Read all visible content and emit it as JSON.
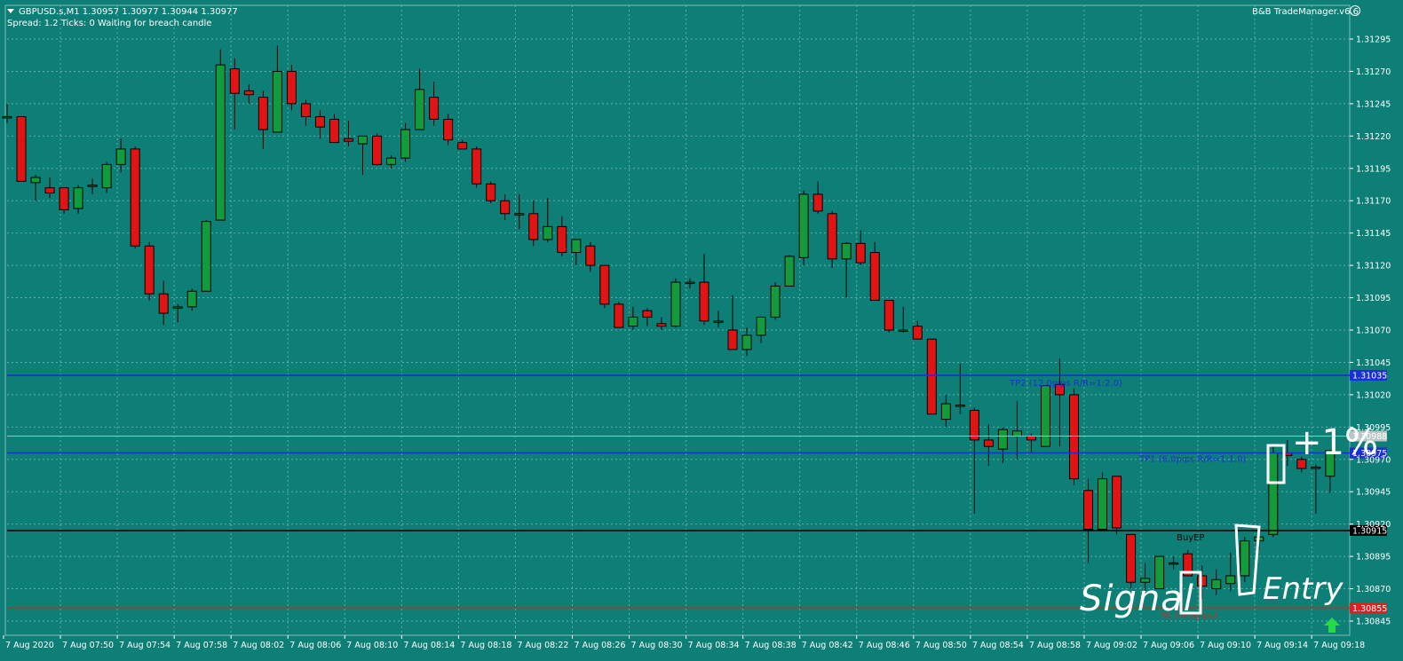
{
  "header": {
    "symbol_line": "GBPUSD.s,M1  1.30957 1.30977 1.30944 1.30977",
    "status_line": "Spread: 1.2   Ticks: 0   Waiting for breach candle",
    "brand": "B&B TradeManager.v6.6"
  },
  "colors": {
    "background": "#0e7f76",
    "bull": "#139a3b",
    "bear": "#e01414",
    "tp_line": "#1b2fd6",
    "entry_line": "#000000",
    "sl_line": "#e02020"
  },
  "chart_data": {
    "type": "candlestick",
    "ylim": [
      1.30835,
      1.3131
    ],
    "y_ticks": [
      "1.31295",
      "1.31270",
      "1.31245",
      "1.31220",
      "1.31195",
      "1.31170",
      "1.31145",
      "1.31120",
      "1.31095",
      "1.31070",
      "1.31045",
      "1.31020",
      "1.30995",
      "1.30970",
      "1.30945",
      "1.30920",
      "1.30895",
      "1.30870",
      "1.30845"
    ],
    "x_tick_labels": [
      "7 Aug 2020",
      "7 Aug 07:50",
      "7 Aug 07:54",
      "7 Aug 07:58",
      "7 Aug 08:02",
      "7 Aug 08:06",
      "7 Aug 08:10",
      "7 Aug 08:14",
      "7 Aug 08:18",
      "7 Aug 08:22",
      "7 Aug 08:26",
      "7 Aug 08:30",
      "7 Aug 08:34",
      "7 Aug 08:38",
      "7 Aug 08:42",
      "7 Aug 08:46",
      "7 Aug 08:50",
      "7 Aug 08:54",
      "7 Aug 08:58",
      "7 Aug 09:02",
      "7 Aug 09:06",
      "7 Aug 09:10",
      "7 Aug 09:14",
      "7 Aug 09:18"
    ],
    "candles": [
      {
        "o": 1.31235,
        "h": 1.31245,
        "l": 1.3123,
        "c": 1.31235
      },
      {
        "o": 1.31235,
        "h": 1.31235,
        "l": 1.31185,
        "c": 1.31185
      },
      {
        "o": 1.31184,
        "h": 1.3119,
        "l": 1.3117,
        "c": 1.31188
      },
      {
        "o": 1.3118,
        "h": 1.31188,
        "l": 1.31172,
        "c": 1.31176
      },
      {
        "o": 1.3118,
        "h": 1.3118,
        "l": 1.3116,
        "c": 1.31163
      },
      {
        "o": 1.31164,
        "h": 1.31182,
        "l": 1.3116,
        "c": 1.3118
      },
      {
        "o": 1.31182,
        "h": 1.31187,
        "l": 1.31175,
        "c": 1.31182
      },
      {
        "o": 1.3118,
        "h": 1.312,
        "l": 1.31176,
        "c": 1.31198
      },
      {
        "o": 1.31198,
        "h": 1.31218,
        "l": 1.31192,
        "c": 1.3121
      },
      {
        "o": 1.3121,
        "h": 1.31212,
        "l": 1.31133,
        "c": 1.31135
      },
      {
        "o": 1.31135,
        "h": 1.31138,
        "l": 1.31093,
        "c": 1.31098
      },
      {
        "o": 1.31098,
        "h": 1.31108,
        "l": 1.31074,
        "c": 1.31083
      },
      {
        "o": 1.31087,
        "h": 1.3109,
        "l": 1.31076,
        "c": 1.31088
      },
      {
        "o": 1.31088,
        "h": 1.31102,
        "l": 1.31085,
        "c": 1.311
      },
      {
        "o": 1.311,
        "h": 1.31155,
        "l": 1.311,
        "c": 1.31154
      },
      {
        "o": 1.31155,
        "h": 1.31287,
        "l": 1.31155,
        "c": 1.31275
      },
      {
        "o": 1.31272,
        "h": 1.3128,
        "l": 1.31225,
        "c": 1.31253
      },
      {
        "o": 1.31255,
        "h": 1.3126,
        "l": 1.31245,
        "c": 1.31252
      },
      {
        "o": 1.3125,
        "h": 1.31255,
        "l": 1.3121,
        "c": 1.31225
      },
      {
        "o": 1.31223,
        "h": 1.3129,
        "l": 1.31223,
        "c": 1.3127
      },
      {
        "o": 1.3127,
        "h": 1.31275,
        "l": 1.3124,
        "c": 1.31245
      },
      {
        "o": 1.31245,
        "h": 1.31248,
        "l": 1.31228,
        "c": 1.31235
      },
      {
        "o": 1.31235,
        "h": 1.3124,
        "l": 1.31218,
        "c": 1.31227
      },
      {
        "o": 1.31233,
        "h": 1.31237,
        "l": 1.31215,
        "c": 1.31215
      },
      {
        "o": 1.31218,
        "h": 1.31232,
        "l": 1.31212,
        "c": 1.31216
      },
      {
        "o": 1.31214,
        "h": 1.3122,
        "l": 1.3119,
        "c": 1.3122
      },
      {
        "o": 1.3122,
        "h": 1.31222,
        "l": 1.31197,
        "c": 1.31198
      },
      {
        "o": 1.31198,
        "h": 1.31205,
        "l": 1.31195,
        "c": 1.31203
      },
      {
        "o": 1.31203,
        "h": 1.3123,
        "l": 1.312,
        "c": 1.31225
      },
      {
        "o": 1.31225,
        "h": 1.31272,
        "l": 1.31225,
        "c": 1.31256
      },
      {
        "o": 1.3125,
        "h": 1.31262,
        "l": 1.31228,
        "c": 1.31233
      },
      {
        "o": 1.31233,
        "h": 1.31237,
        "l": 1.31213,
        "c": 1.31217
      },
      {
        "o": 1.31215,
        "h": 1.31217,
        "l": 1.3121,
        "c": 1.3121
      },
      {
        "o": 1.3121,
        "h": 1.31212,
        "l": 1.3118,
        "c": 1.31183
      },
      {
        "o": 1.31183,
        "h": 1.31185,
        "l": 1.31168,
        "c": 1.3117
      },
      {
        "o": 1.3117,
        "h": 1.31175,
        "l": 1.31155,
        "c": 1.3116
      },
      {
        "o": 1.3116,
        "h": 1.31175,
        "l": 1.31148,
        "c": 1.3116
      },
      {
        "o": 1.3116,
        "h": 1.3117,
        "l": 1.31135,
        "c": 1.3114
      },
      {
        "o": 1.3114,
        "h": 1.31172,
        "l": 1.31138,
        "c": 1.3115
      },
      {
        "o": 1.3115,
        "h": 1.31158,
        "l": 1.31127,
        "c": 1.3113
      },
      {
        "o": 1.3113,
        "h": 1.31138,
        "l": 1.3112,
        "c": 1.3114
      },
      {
        "o": 1.31135,
        "h": 1.31138,
        "l": 1.31115,
        "c": 1.3112
      },
      {
        "o": 1.3112,
        "h": 1.3112,
        "l": 1.31087,
        "c": 1.3109
      },
      {
        "o": 1.3109,
        "h": 1.31092,
        "l": 1.31072,
        "c": 1.31072
      },
      {
        "o": 1.31073,
        "h": 1.31088,
        "l": 1.3107,
        "c": 1.3108
      },
      {
        "o": 1.31085,
        "h": 1.31087,
        "l": 1.31073,
        "c": 1.3108
      },
      {
        "o": 1.31075,
        "h": 1.3108,
        "l": 1.3107,
        "c": 1.31073
      },
      {
        "o": 1.31073,
        "h": 1.3111,
        "l": 1.31072,
        "c": 1.31107
      },
      {
        "o": 1.31107,
        "h": 1.3111,
        "l": 1.31102,
        "c": 1.31107
      },
      {
        "o": 1.31107,
        "h": 1.31129,
        "l": 1.31074,
        "c": 1.31077
      },
      {
        "o": 1.31077,
        "h": 1.31085,
        "l": 1.31072,
        "c": 1.31077
      },
      {
        "o": 1.3107,
        "h": 1.31097,
        "l": 1.31055,
        "c": 1.31055
      },
      {
        "o": 1.31055,
        "h": 1.31072,
        "l": 1.3105,
        "c": 1.31066
      },
      {
        "o": 1.31066,
        "h": 1.31077,
        "l": 1.3106,
        "c": 1.3108
      },
      {
        "o": 1.3108,
        "h": 1.31107,
        "l": 1.31078,
        "c": 1.31104
      },
      {
        "o": 1.31104,
        "h": 1.31128,
        "l": 1.31104,
        "c": 1.31127
      },
      {
        "o": 1.31126,
        "h": 1.31178,
        "l": 1.3112,
        "c": 1.31175
      },
      {
        "o": 1.31175,
        "h": 1.31185,
        "l": 1.3116,
        "c": 1.31162
      },
      {
        "o": 1.3116,
        "h": 1.31162,
        "l": 1.31118,
        "c": 1.31125
      },
      {
        "o": 1.31125,
        "h": 1.31138,
        "l": 1.31095,
        "c": 1.31137
      },
      {
        "o": 1.31137,
        "h": 1.31147,
        "l": 1.3112,
        "c": 1.31122
      },
      {
        "o": 1.3113,
        "h": 1.31138,
        "l": 1.31093,
        "c": 1.31093
      },
      {
        "o": 1.31093,
        "h": 1.31093,
        "l": 1.31068,
        "c": 1.3107
      },
      {
        "o": 1.3107,
        "h": 1.31088,
        "l": 1.31068,
        "c": 1.3107
      },
      {
        "o": 1.31073,
        "h": 1.31077,
        "l": 1.31063,
        "c": 1.31063
      },
      {
        "o": 1.31063,
        "h": 1.31063,
        "l": 1.31005,
        "c": 1.31005
      },
      {
        "o": 1.31001,
        "h": 1.3102,
        "l": 1.30995,
        "c": 1.31013
      },
      {
        "o": 1.31011,
        "h": 1.31044,
        "l": 1.31005,
        "c": 1.31012
      },
      {
        "o": 1.31008,
        "h": 1.3101,
        "l": 1.30928,
        "c": 1.30985
      },
      {
        "o": 1.30985,
        "h": 1.30997,
        "l": 1.30965,
        "c": 1.3098
      },
      {
        "o": 1.30978,
        "h": 1.30995,
        "l": 1.30967,
        "c": 1.30993
      },
      {
        "o": 1.30988,
        "h": 1.31015,
        "l": 1.3097,
        "c": 1.30992
      },
      {
        "o": 1.30988,
        "h": 1.3099,
        "l": 1.30975,
        "c": 1.30985
      },
      {
        "o": 1.3098,
        "h": 1.31027,
        "l": 1.3098,
        "c": 1.31027
      },
      {
        "o": 1.31028,
        "h": 1.31048,
        "l": 1.3098,
        "c": 1.3102
      },
      {
        "o": 1.3102,
        "h": 1.31025,
        "l": 1.3095,
        "c": 1.30955
      },
      {
        "o": 1.30946,
        "h": 1.30955,
        "l": 1.3089,
        "c": 1.30916
      },
      {
        "o": 1.30916,
        "h": 1.3096,
        "l": 1.30915,
        "c": 1.30955
      },
      {
        "o": 1.30957,
        "h": 1.30957,
        "l": 1.30912,
        "c": 1.30917
      },
      {
        "o": 1.30912,
        "h": 1.30912,
        "l": 1.3087,
        "c": 1.30875
      },
      {
        "o": 1.30875,
        "h": 1.3089,
        "l": 1.30865,
        "c": 1.30878
      },
      {
        "o": 1.3087,
        "h": 1.30895,
        "l": 1.3087,
        "c": 1.30895
      },
      {
        "o": 1.3089,
        "h": 1.30895,
        "l": 1.30885,
        "c": 1.3089
      },
      {
        "o": 1.30897,
        "h": 1.309,
        "l": 1.3088,
        "c": 1.3088
      },
      {
        "o": 1.3088,
        "h": 1.30888,
        "l": 1.30862,
        "c": 1.30872
      },
      {
        "o": 1.3087,
        "h": 1.30885,
        "l": 1.30865,
        "c": 1.30877
      },
      {
        "o": 1.30874,
        "h": 1.30898,
        "l": 1.30868,
        "c": 1.3088
      },
      {
        "o": 1.3088,
        "h": 1.3091,
        "l": 1.30875,
        "c": 1.30907
      },
      {
        "o": 1.30907,
        "h": 1.30912,
        "l": 1.309,
        "c": 1.3091
      },
      {
        "o": 1.30912,
        "h": 1.3098,
        "l": 1.3091,
        "c": 1.30975
      },
      {
        "o": 1.30975,
        "h": 1.30985,
        "l": 1.30965,
        "c": 1.30973
      },
      {
        "o": 1.3097,
        "h": 1.30972,
        "l": 1.3096,
        "c": 1.30963
      },
      {
        "o": 1.30964,
        "h": 1.30966,
        "l": 1.30928,
        "c": 1.30964
      },
      {
        "o": 1.30957,
        "h": 1.30977,
        "l": 1.30944,
        "c": 1.30977
      }
    ],
    "levels": [
      {
        "name": "TP2",
        "price": 1.31035,
        "label": "TP2 (12.0pips R/R=1:2.0)",
        "price_tag": "1.31035",
        "color": "#1b2fd6"
      },
      {
        "name": "TP1",
        "price": 1.30975,
        "label": "TP1 (6.0pips R/R=1:1.0)",
        "price_tag": "1.30975",
        "color": "#1b2fd6"
      },
      {
        "name": "BuyEP",
        "price": 1.30915,
        "label": "BuyEP",
        "price_tag": "1.30915",
        "color": "#000000"
      },
      {
        "name": "SL",
        "price": 1.30855,
        "label": "SL (-6.0pips)",
        "price_tag": "1.30855",
        "color": "#e02020"
      }
    ],
    "bid_price_tag": "1.30988",
    "annotations": {
      "signal": "Signal",
      "entry": "Entry",
      "profit": "+1%"
    }
  }
}
